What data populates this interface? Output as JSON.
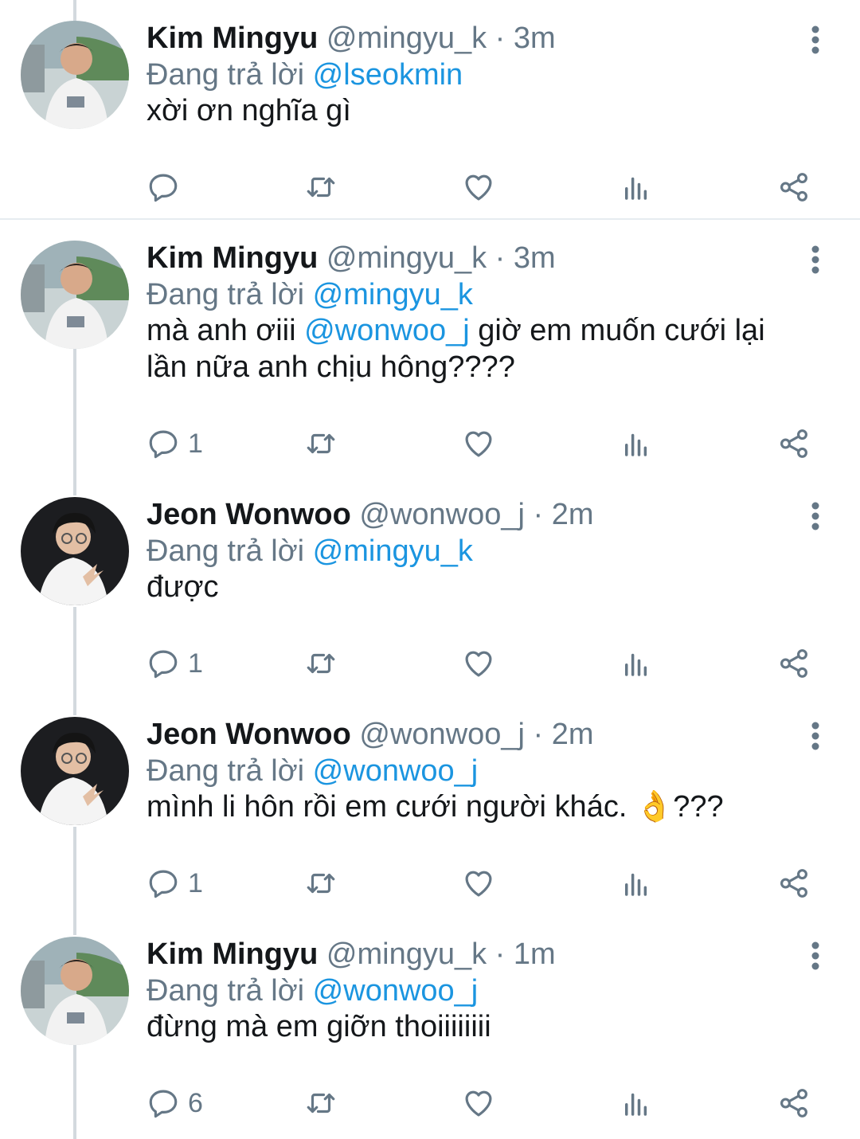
{
  "colors": {
    "accent": "#1b95e0",
    "muted": "#657786",
    "text": "#14171a"
  },
  "icons": {
    "reply": "reply-icon",
    "retweet": "retweet-icon",
    "like": "heart-icon",
    "analytics": "analytics-icon",
    "share": "share-icon",
    "more": "more-vertical-icon"
  },
  "tweets": [
    {
      "name": "Kim Mingyu",
      "handle": "@mingyu_k",
      "sep": "·",
      "time": "3m",
      "reply_prefix": "Đang trả lời",
      "reply_to": "@lseokmin",
      "text": "xời ơn nghĩa gì",
      "replies": ""
    },
    {
      "name": "Kim Mingyu",
      "handle": "@mingyu_k",
      "sep": "·",
      "time": "3m",
      "reply_prefix": "Đang trả lời",
      "reply_to": "@mingyu_k",
      "text_before": "mà anh ơiii ",
      "text_mention": "@wonwoo_j",
      "text_after": " giờ em muốn cưới lại lần nữa anh chịu hông????",
      "replies": "1"
    },
    {
      "name": "Jeon Wonwoo",
      "handle": "@wonwoo_j",
      "sep": "·",
      "time": "2m",
      "reply_prefix": "Đang trả lời",
      "reply_to": "@mingyu_k",
      "text": "được",
      "replies": "1"
    },
    {
      "name": "Jeon Wonwoo",
      "handle": "@wonwoo_j",
      "sep": "·",
      "time": "2m",
      "reply_prefix": "Đang trả lời",
      "reply_to": "@wonwoo_j",
      "text": "mình li hôn rồi em cưới người khác. 👌???",
      "replies": "1"
    },
    {
      "name": "Kim Mingyu",
      "handle": "@mingyu_k",
      "sep": "·",
      "time": "1m",
      "reply_prefix": "Đang trả lời",
      "reply_to": "@wonwoo_j",
      "text": "đừng mà em giỡn thoiiiiiiii",
      "replies": "6"
    }
  ]
}
